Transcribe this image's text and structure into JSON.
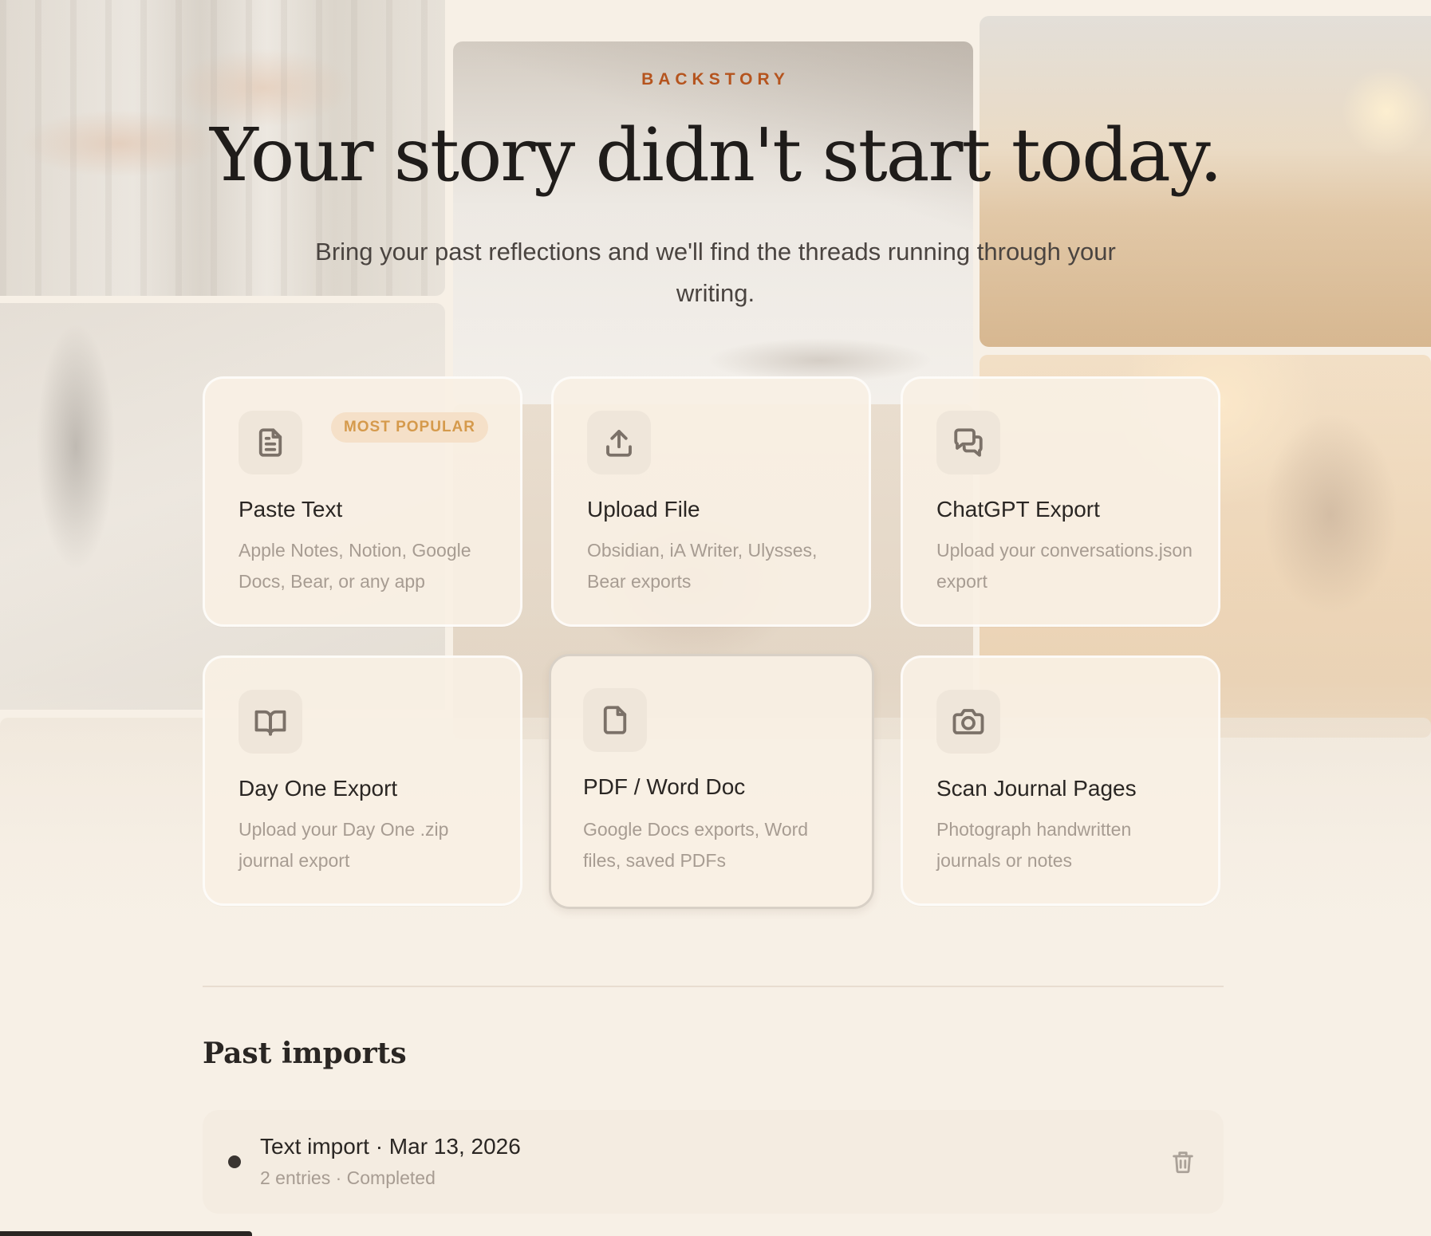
{
  "hero": {
    "eyebrow": "BACKSTORY",
    "title": "Your story didn't start today.",
    "subtitle": "Bring your past reflections and we'll find the threads running through your writing."
  },
  "sources": [
    {
      "title": "Paste Text",
      "description": "Apple Notes, Notion, Google Docs, Bear, or any app",
      "icon": "document-text-icon",
      "badge": "MOST POPULAR"
    },
    {
      "title": "Upload File",
      "description": "Obsidian, iA Writer, Ulysses, Bear exports",
      "icon": "upload-icon"
    },
    {
      "title": "ChatGPT Export",
      "description": "Upload your conversations.json export",
      "icon": "chat-bubbles-icon"
    },
    {
      "title": "Day One Export",
      "description": "Upload your Day One .zip journal export",
      "icon": "book-open-icon"
    },
    {
      "title": "PDF / Word Doc",
      "description": "Google Docs exports, Word files, saved PDFs",
      "icon": "file-icon"
    },
    {
      "title": "Scan Journal Pages",
      "description": "Photograph handwritten journals or notes",
      "icon": "camera-icon"
    }
  ],
  "past_imports": {
    "heading": "Past imports",
    "items": [
      {
        "title": "Text import · Mar 13, 2026",
        "subtitle": "2 entries · Completed",
        "icon": "trash-icon"
      }
    ]
  },
  "colors": {
    "accent": "#b5541e",
    "badge_bg": "#f5e0c8",
    "badge_text": "#d59a4c",
    "background": "#f7f0e6"
  }
}
